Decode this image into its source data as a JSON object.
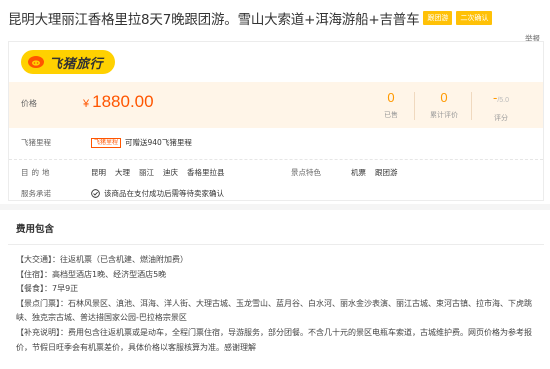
{
  "title": {
    "text": "昆明大理丽江香格里拉8天7晚跟团游。雪山大索道+洱海游船+吉普车",
    "tags": [
      "跟团游",
      "二次确认"
    ]
  },
  "report_label": "举报",
  "brand": {
    "name": "飞猪旅行"
  },
  "price": {
    "label": "价格",
    "currency": "¥",
    "value": "1880.00"
  },
  "stats": [
    {
      "value": "0",
      "label": "已售"
    },
    {
      "value": "0",
      "label": "累计评价"
    },
    {
      "value": "-",
      "max": "/5.0",
      "label": "评分"
    }
  ],
  "mileage": {
    "label": "飞猪里程",
    "badge": "飞猪里程",
    "text": "可赠送940飞猪里程"
  },
  "destination": {
    "label": "目的地",
    "items": [
      "昆明",
      "大理",
      "丽江",
      "迪庆",
      "香格里拉县"
    ]
  },
  "features": {
    "label": "景点特色",
    "items": [
      "机票",
      "跟团游"
    ]
  },
  "promise": {
    "label": "服务承诺",
    "text": "该商品在支付成功后需等待卖家确认"
  },
  "fees": {
    "title": "费用包含",
    "lines": [
      "【大交通】：往返机票（已含机建、燃油附加费）",
      "【住宿】：高档型酒店1晚、经济型酒店5晚",
      "【餐食】：7早9正",
      "【景点门票】：石林风景区、滇池、洱海、洋人街、大理古城、玉龙雪山、蓝月谷、白水河、丽水金沙表演、丽江古城、束河古镇、拉市海、下虎跳峡、独克宗古城、普达措国家公园-巴拉格宗景区",
      "【补充说明】：费用包含往返机票或是动车，全程门票住宿，导游服务，部分团餐。不含几十元的景区电瓶车索道，古城维护费。网页价格为参考报价，节假日旺季会有机票差价，具体价格以客服核算为准。感谢理解"
    ]
  },
  "colors": {
    "accent": "#ff5500",
    "brand_yellow": "#ffd100",
    "tag_yellow": "#ffc107",
    "stat_orange": "#ff9900",
    "price_bg": "#fff5e8"
  }
}
